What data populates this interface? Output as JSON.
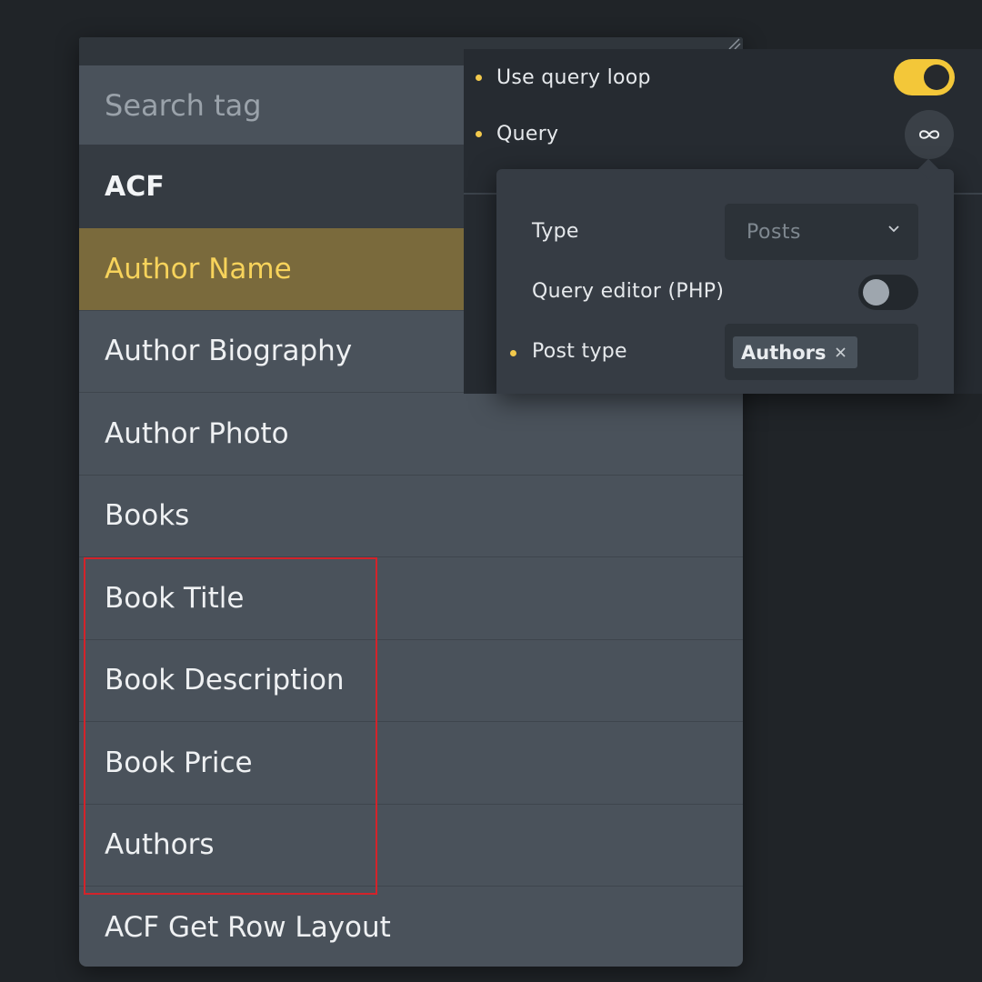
{
  "tag_dropdown": {
    "search_placeholder": "Search tag",
    "group_header": "ACF",
    "items": [
      {
        "label": "Author Name",
        "active": true
      },
      {
        "label": "Author Biography"
      },
      {
        "label": "Author Photo"
      },
      {
        "label": "Books"
      },
      {
        "label": "Book Title"
      },
      {
        "label": "Book Description"
      },
      {
        "label": "Book Price"
      },
      {
        "label": "Authors"
      },
      {
        "label": "ACF Get Row Layout"
      }
    ]
  },
  "settings": {
    "use_query_loop": {
      "label": "Use query loop",
      "enabled": true
    },
    "query": {
      "label": "Query",
      "icon": "infinity-icon"
    }
  },
  "query_popover": {
    "type": {
      "label": "Type",
      "value": "Posts"
    },
    "query_editor": {
      "label": "Query editor (PHP)",
      "enabled": false
    },
    "post_type": {
      "label": "Post type",
      "tags": [
        "Authors"
      ]
    }
  },
  "colors": {
    "accent": "#f3c739",
    "active_item_text": "#f7d35b",
    "highlight_border": "#d3232a"
  }
}
